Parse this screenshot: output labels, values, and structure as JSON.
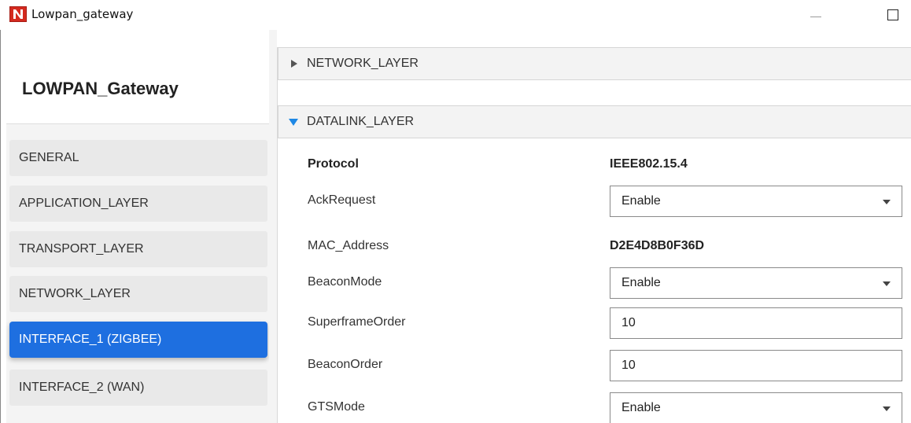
{
  "window": {
    "title": "Lowpan_gateway"
  },
  "sidebar": {
    "title": "LOWPAN_Gateway",
    "items": [
      {
        "label": "GENERAL",
        "active": false
      },
      {
        "label": "APPLICATION_LAYER",
        "active": false
      },
      {
        "label": "TRANSPORT_LAYER",
        "active": false
      },
      {
        "label": "NETWORK_LAYER",
        "active": false
      },
      {
        "label": "INTERFACE_1 (ZIGBEE)",
        "active": true
      },
      {
        "label": "INTERFACE_2 (WAN)",
        "active": false
      }
    ]
  },
  "sections": {
    "network": {
      "label": "NETWORK_LAYER",
      "expanded": false
    },
    "datalink": {
      "label": "DATALINK_LAYER",
      "expanded": true
    }
  },
  "fields": {
    "protocol": {
      "label": "Protocol",
      "value": "IEEE802.15.4"
    },
    "ack_request": {
      "label": "AckRequest",
      "value": "Enable"
    },
    "mac_address": {
      "label": "MAC_Address",
      "value": "D2E4D8B0F36D"
    },
    "beacon_mode": {
      "label": "BeaconMode",
      "value": "Enable"
    },
    "superframe_order": {
      "label": "SuperframeOrder",
      "value": "10"
    },
    "beacon_order": {
      "label": "BeaconOrder",
      "value": "10"
    },
    "gts_mode": {
      "label": "GTSMode",
      "value": "Enable"
    }
  },
  "colors": {
    "accent": "#1e6fe0",
    "expand_arrow": "#1e88e5",
    "app_icon": "#d42a1f"
  },
  "icons": {
    "app": "app-logo-icon",
    "minimize": "minimize-icon",
    "maximize": "maximize-icon",
    "collapsed": "triangle-right-icon",
    "expanded": "triangle-down-icon",
    "dropdown": "chevron-down-icon"
  }
}
